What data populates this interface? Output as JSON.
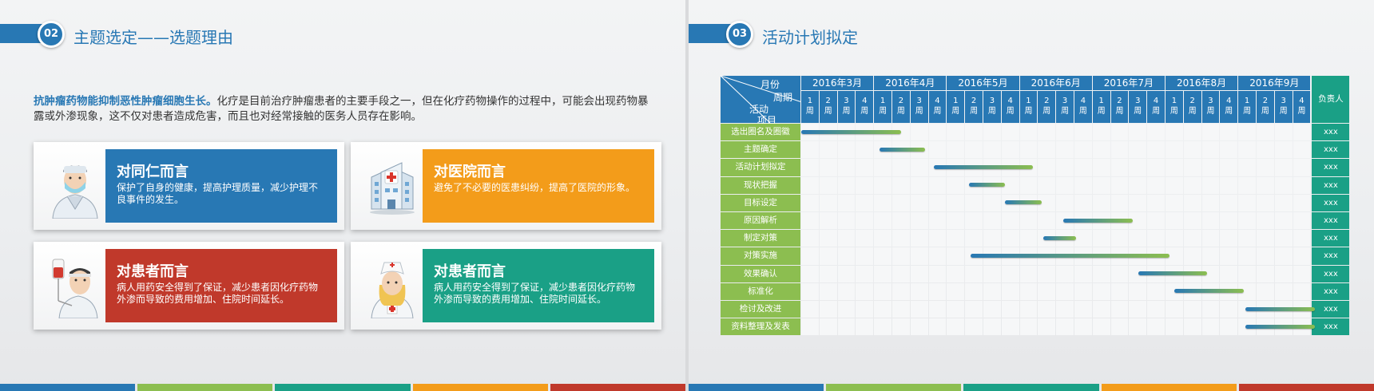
{
  "colors": {
    "blue": "#2878b4",
    "orange": "#f39c1a",
    "red": "#c0392b",
    "teal": "#1aa086",
    "green": "#8cbe50"
  },
  "left": {
    "badge": "02",
    "title": "主题选定——选题理由",
    "intro_bold": "抗肿瘤药物能抑制恶性肿瘤细胞生长。",
    "intro_text": "化疗是目前治疗肿瘤患者的主要手段之一，但在化疗药物操作的过程中，可能会出现药物暴露或外渗现象，这不仅对患者造成危害，而且也对经常接触的医务人员存在影响。",
    "cards": [
      {
        "title": "对同仁而言",
        "text": "保护了自身的健康，提高护理质量，减少护理不良事件的发生。",
        "color": "#2878b4",
        "icon": "male-doctor-icon"
      },
      {
        "title": "对医院而言",
        "text": "避免了不必要的医患纠纷，提高了医院的形象。",
        "color": "#f39c1a",
        "icon": "hospital-icon"
      },
      {
        "title": "对患者而言",
        "text": "病人用药安全得到了保证，减少患者因化疗药物外渗而导致的费用增加、住院时间延长。",
        "color": "#c0392b",
        "icon": "patient-iv-icon"
      },
      {
        "title": "对患者而言",
        "text": "病人用药安全得到了保证，减少患者因化疗药物外渗而导致的费用增加、住院时间延长。",
        "color": "#1aa086",
        "icon": "nurse-icon"
      }
    ]
  },
  "right": {
    "badge": "03",
    "title": "活动计划拟定",
    "gantt": {
      "header_month": "月份",
      "header_week": "周期",
      "header_activity": "活动",
      "header_item": "项目",
      "owner_header": "负责人",
      "months": [
        "2016年3月",
        "2016年4月",
        "2016年5月",
        "2016年6月",
        "2016年7月",
        "2016年8月",
        "2016年9月"
      ],
      "week_labels": [
        "1周",
        "2周",
        "3周",
        "4周"
      ],
      "tasks": [
        {
          "name": "选出圈名及圈徽",
          "owner": "xxx",
          "start_week": 1,
          "end_week": 6.5
        },
        {
          "name": "主题确定",
          "owner": "xxx",
          "start_week": 5.3,
          "end_week": 7.8
        },
        {
          "name": "活动计划拟定",
          "owner": "xxx",
          "start_week": 8.3,
          "end_week": 13.7
        },
        {
          "name": "现状把握",
          "owner": "xxx",
          "start_week": 10.2,
          "end_week": 12.2
        },
        {
          "name": "目标设定",
          "owner": "xxx",
          "start_week": 12.2,
          "end_week": 14.2
        },
        {
          "name": "原因解析",
          "owner": "xxx",
          "start_week": 15.4,
          "end_week": 19.2
        },
        {
          "name": "制定对策",
          "owner": "xxx",
          "start_week": 14.3,
          "end_week": 16.1
        },
        {
          "name": "对策实施",
          "owner": "xxx",
          "start_week": 10.3,
          "end_week": 21.2
        },
        {
          "name": "效果确认",
          "owner": "xxx",
          "start_week": 19.5,
          "end_week": 23.3
        },
        {
          "name": "标准化",
          "owner": "xxx",
          "start_week": 21.5,
          "end_week": 25.3
        },
        {
          "name": "检讨及改进",
          "owner": "xxx",
          "start_week": 25.4,
          "end_week": 29.2
        },
        {
          "name": "资料整理及发表",
          "owner": "xxx",
          "start_week": 25.4,
          "end_week": 29.2
        }
      ]
    }
  },
  "stripes": [
    "#2878b4",
    "#8cbe50",
    "#1aa086",
    "#f39c1a",
    "#c0392b"
  ]
}
